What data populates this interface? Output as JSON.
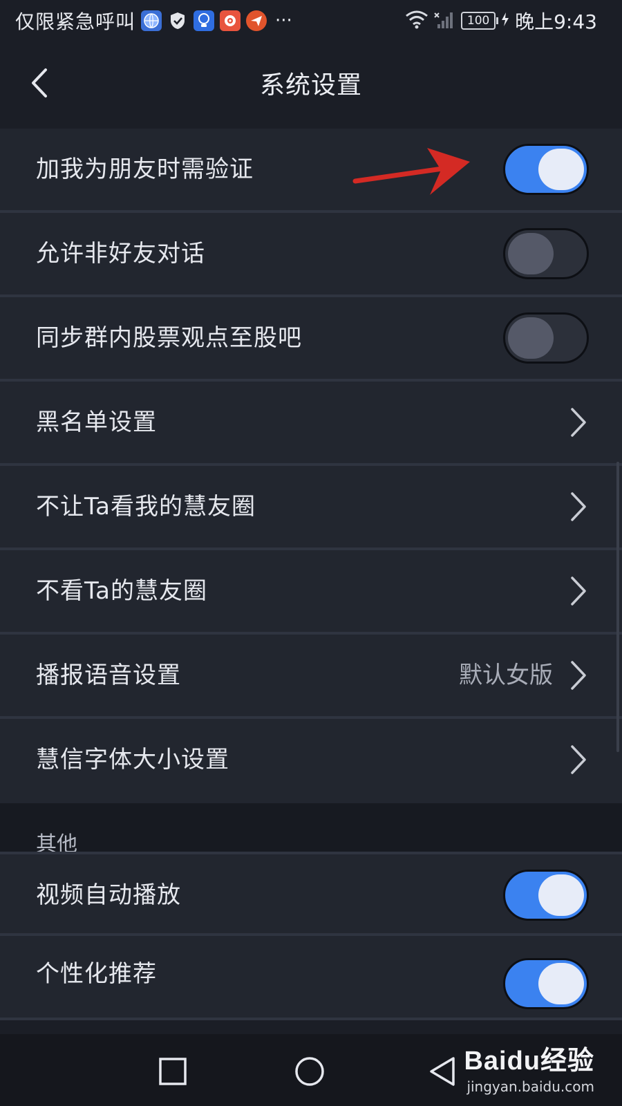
{
  "status_bar": {
    "left_text": "仅限紧急呼叫",
    "battery": "100",
    "time": "晚上9:43",
    "app_icons": [
      "globe-icon",
      "shield-icon",
      "bulb-icon",
      "weibo-icon",
      "paper-plane-icon"
    ],
    "more": "···"
  },
  "header": {
    "title": "系统设置"
  },
  "settings": [
    {
      "label": "加我为朋友时需验证",
      "type": "toggle",
      "on": true
    },
    {
      "label": "允许非好友对话",
      "type": "toggle",
      "on": false
    },
    {
      "label": "同步群内股票观点至股吧",
      "type": "toggle",
      "on": false
    },
    {
      "label": "黑名单设置",
      "type": "link"
    },
    {
      "label": "不让Ta看我的慧友圈",
      "type": "link"
    },
    {
      "label": "不看Ta的慧友圈",
      "type": "link"
    },
    {
      "label": "播报语音设置",
      "type": "link",
      "value": "默认女版"
    },
    {
      "label": "慧信字体大小设置",
      "type": "link"
    }
  ],
  "other_section": {
    "title": "其他",
    "items": [
      {
        "label": "视频自动播放",
        "type": "toggle",
        "on": true
      },
      {
        "label": "个性化推荐",
        "type": "toggle",
        "on": true
      }
    ]
  },
  "watermark": {
    "main": "Baidu经验",
    "sub": "jingyan.baidu.com"
  },
  "colors": {
    "toggle_on": "#3b82f0",
    "toggle_off": "#2c303a",
    "background": "#1b1e26",
    "row": "#22262f",
    "arrow": "#d42a24"
  }
}
